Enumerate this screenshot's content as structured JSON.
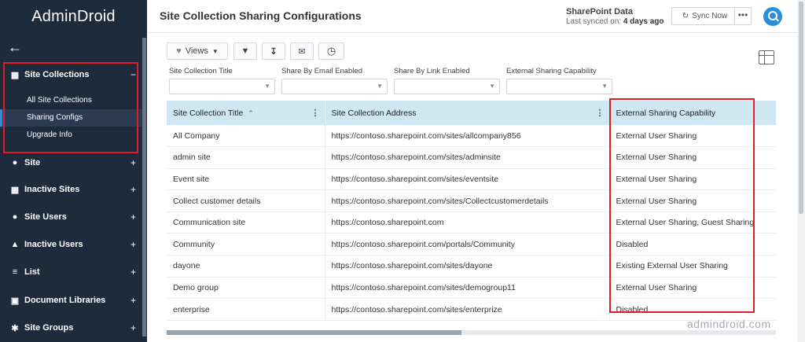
{
  "brand": "AdminDroid",
  "sidebar": {
    "groups": [
      {
        "label": "Site Collections",
        "icon": "sitemap-icon",
        "toggle": "−",
        "expanded": true,
        "items": [
          {
            "label": "All Site Collections"
          },
          {
            "label": "Sharing Configs",
            "active": true
          },
          {
            "label": "Upgrade Info"
          }
        ]
      },
      {
        "label": "Site",
        "icon": "globe-icon",
        "toggle": "+"
      },
      {
        "label": "Inactive Sites",
        "icon": "calendar-icon",
        "toggle": "+"
      },
      {
        "label": "Site Users",
        "icon": "globe-users-icon",
        "toggle": "+"
      },
      {
        "label": "Inactive Users",
        "icon": "user-icon",
        "toggle": "+"
      },
      {
        "label": "List",
        "icon": "list-icon",
        "toggle": "+"
      },
      {
        "label": "Document Libraries",
        "icon": "document-library-icon",
        "toggle": "+"
      },
      {
        "label": "Site Groups",
        "icon": "group-icon",
        "toggle": "+"
      }
    ]
  },
  "header": {
    "title": "Site Collection Sharing Configurations",
    "data_source": "SharePoint Data",
    "last_synced_prefix": "Last synced on:",
    "last_synced_value": "4 days ago",
    "sync_label": "Sync Now",
    "more_label": "•••"
  },
  "toolbar": {
    "views_label": "Views"
  },
  "filters": [
    {
      "label": "Site Collection Title",
      "value": ""
    },
    {
      "label": "Share By Email Enabled",
      "value": ""
    },
    {
      "label": "Share By Link Enabled",
      "value": ""
    },
    {
      "label": "External Sharing Capability",
      "value": ""
    }
  ],
  "table": {
    "columns": [
      "Site Collection Title",
      "Site Collection Address",
      "External Sharing Capability"
    ],
    "rows": [
      [
        "All Company",
        "https://contoso.sharepoint.com/sites/allcompany856",
        "External User Sharing"
      ],
      [
        "admin site",
        "https://contoso.sharepoint.com/sites/adminsite",
        "External User Sharing"
      ],
      [
        "Event site",
        "https://contoso.sharepoint.com/sites/eventsite",
        "External User Sharing"
      ],
      [
        "Collect customer details",
        "https://contoso.sharepoint.com/sites/Collectcustomerdetails",
        "External User Sharing"
      ],
      [
        "Communication site",
        "https://contoso.sharepoint.com",
        "External User Sharing, Guest Sharing"
      ],
      [
        "Community",
        "https://contoso.sharepoint.com/portals/Community",
        "Disabled"
      ],
      [
        "dayone",
        "https://contoso.sharepoint.com/sites/dayone",
        "Existing External User Sharing"
      ],
      [
        "Demo group",
        "https://contoso.sharepoint.com/sites/demogroup11",
        "External User Sharing"
      ],
      [
        "enterprise",
        "https://contoso.sharepoint.com/sites/enterprize",
        "Disabled"
      ]
    ]
  },
  "watermark": "admindroid.com",
  "colors": {
    "sidebar_bg": "#1e2b3c",
    "accent": "#2a8fd8",
    "header_row": "#cfe7f2",
    "highlight_box": "#e01c24"
  }
}
